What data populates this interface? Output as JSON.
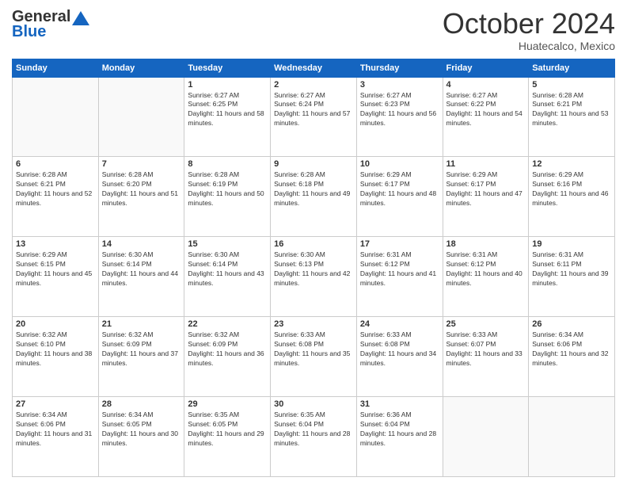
{
  "header": {
    "logo_line1": "General",
    "logo_line2": "Blue",
    "month": "October 2024",
    "location": "Huatecalco, Mexico"
  },
  "days_of_week": [
    "Sunday",
    "Monday",
    "Tuesday",
    "Wednesday",
    "Thursday",
    "Friday",
    "Saturday"
  ],
  "weeks": [
    [
      {
        "day": "",
        "info": ""
      },
      {
        "day": "",
        "info": ""
      },
      {
        "day": "1",
        "info": "Sunrise: 6:27 AM\nSunset: 6:25 PM\nDaylight: 11 hours and 58 minutes."
      },
      {
        "day": "2",
        "info": "Sunrise: 6:27 AM\nSunset: 6:24 PM\nDaylight: 11 hours and 57 minutes."
      },
      {
        "day": "3",
        "info": "Sunrise: 6:27 AM\nSunset: 6:23 PM\nDaylight: 11 hours and 56 minutes."
      },
      {
        "day": "4",
        "info": "Sunrise: 6:27 AM\nSunset: 6:22 PM\nDaylight: 11 hours and 54 minutes."
      },
      {
        "day": "5",
        "info": "Sunrise: 6:28 AM\nSunset: 6:21 PM\nDaylight: 11 hours and 53 minutes."
      }
    ],
    [
      {
        "day": "6",
        "info": "Sunrise: 6:28 AM\nSunset: 6:21 PM\nDaylight: 11 hours and 52 minutes."
      },
      {
        "day": "7",
        "info": "Sunrise: 6:28 AM\nSunset: 6:20 PM\nDaylight: 11 hours and 51 minutes."
      },
      {
        "day": "8",
        "info": "Sunrise: 6:28 AM\nSunset: 6:19 PM\nDaylight: 11 hours and 50 minutes."
      },
      {
        "day": "9",
        "info": "Sunrise: 6:28 AM\nSunset: 6:18 PM\nDaylight: 11 hours and 49 minutes."
      },
      {
        "day": "10",
        "info": "Sunrise: 6:29 AM\nSunset: 6:17 PM\nDaylight: 11 hours and 48 minutes."
      },
      {
        "day": "11",
        "info": "Sunrise: 6:29 AM\nSunset: 6:17 PM\nDaylight: 11 hours and 47 minutes."
      },
      {
        "day": "12",
        "info": "Sunrise: 6:29 AM\nSunset: 6:16 PM\nDaylight: 11 hours and 46 minutes."
      }
    ],
    [
      {
        "day": "13",
        "info": "Sunrise: 6:29 AM\nSunset: 6:15 PM\nDaylight: 11 hours and 45 minutes."
      },
      {
        "day": "14",
        "info": "Sunrise: 6:30 AM\nSunset: 6:14 PM\nDaylight: 11 hours and 44 minutes."
      },
      {
        "day": "15",
        "info": "Sunrise: 6:30 AM\nSunset: 6:14 PM\nDaylight: 11 hours and 43 minutes."
      },
      {
        "day": "16",
        "info": "Sunrise: 6:30 AM\nSunset: 6:13 PM\nDaylight: 11 hours and 42 minutes."
      },
      {
        "day": "17",
        "info": "Sunrise: 6:31 AM\nSunset: 6:12 PM\nDaylight: 11 hours and 41 minutes."
      },
      {
        "day": "18",
        "info": "Sunrise: 6:31 AM\nSunset: 6:12 PM\nDaylight: 11 hours and 40 minutes."
      },
      {
        "day": "19",
        "info": "Sunrise: 6:31 AM\nSunset: 6:11 PM\nDaylight: 11 hours and 39 minutes."
      }
    ],
    [
      {
        "day": "20",
        "info": "Sunrise: 6:32 AM\nSunset: 6:10 PM\nDaylight: 11 hours and 38 minutes."
      },
      {
        "day": "21",
        "info": "Sunrise: 6:32 AM\nSunset: 6:09 PM\nDaylight: 11 hours and 37 minutes."
      },
      {
        "day": "22",
        "info": "Sunrise: 6:32 AM\nSunset: 6:09 PM\nDaylight: 11 hours and 36 minutes."
      },
      {
        "day": "23",
        "info": "Sunrise: 6:33 AM\nSunset: 6:08 PM\nDaylight: 11 hours and 35 minutes."
      },
      {
        "day": "24",
        "info": "Sunrise: 6:33 AM\nSunset: 6:08 PM\nDaylight: 11 hours and 34 minutes."
      },
      {
        "day": "25",
        "info": "Sunrise: 6:33 AM\nSunset: 6:07 PM\nDaylight: 11 hours and 33 minutes."
      },
      {
        "day": "26",
        "info": "Sunrise: 6:34 AM\nSunset: 6:06 PM\nDaylight: 11 hours and 32 minutes."
      }
    ],
    [
      {
        "day": "27",
        "info": "Sunrise: 6:34 AM\nSunset: 6:06 PM\nDaylight: 11 hours and 31 minutes."
      },
      {
        "day": "28",
        "info": "Sunrise: 6:34 AM\nSunset: 6:05 PM\nDaylight: 11 hours and 30 minutes."
      },
      {
        "day": "29",
        "info": "Sunrise: 6:35 AM\nSunset: 6:05 PM\nDaylight: 11 hours and 29 minutes."
      },
      {
        "day": "30",
        "info": "Sunrise: 6:35 AM\nSunset: 6:04 PM\nDaylight: 11 hours and 28 minutes."
      },
      {
        "day": "31",
        "info": "Sunrise: 6:36 AM\nSunset: 6:04 PM\nDaylight: 11 hours and 28 minutes."
      },
      {
        "day": "",
        "info": ""
      },
      {
        "day": "",
        "info": ""
      }
    ]
  ]
}
